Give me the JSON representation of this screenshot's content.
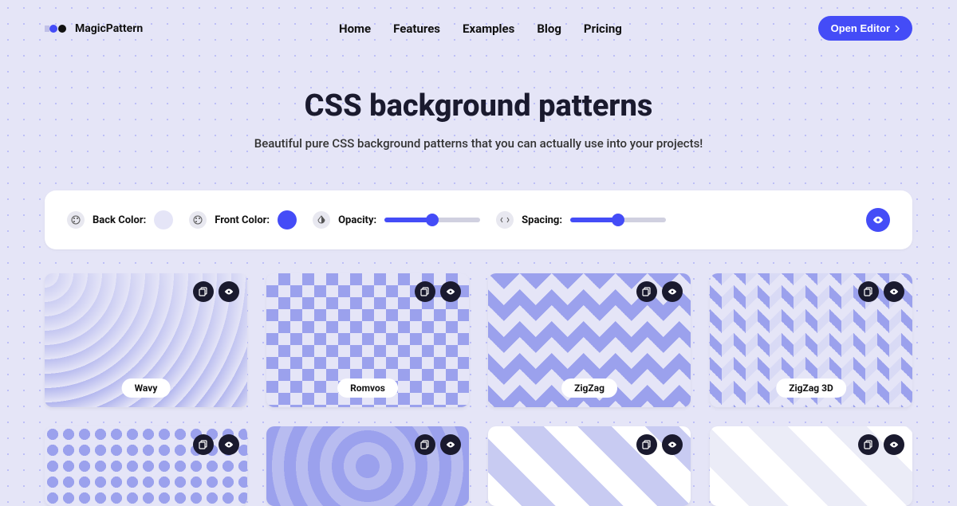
{
  "header": {
    "brand": "MagicPattern",
    "nav": [
      "Home",
      "Features",
      "Examples",
      "Blog",
      "Pricing"
    ],
    "cta": "Open Editor"
  },
  "hero": {
    "title": "CSS background patterns",
    "subtitle": "Beautiful pure CSS background patterns that you can actually use into your projects!"
  },
  "toolbar": {
    "back_color_label": "Back Color:",
    "back_color_value": "#e5e5f7",
    "front_color_label": "Front Color:",
    "front_color_value": "#444cf7",
    "opacity_label": "Opacity:",
    "opacity_value": 50,
    "spacing_label": "Spacing:",
    "spacing_value": 48
  },
  "patterns": [
    {
      "name": "Wavy"
    },
    {
      "name": "Romvos"
    },
    {
      "name": "ZigZag"
    },
    {
      "name": "ZigZag 3D"
    }
  ]
}
